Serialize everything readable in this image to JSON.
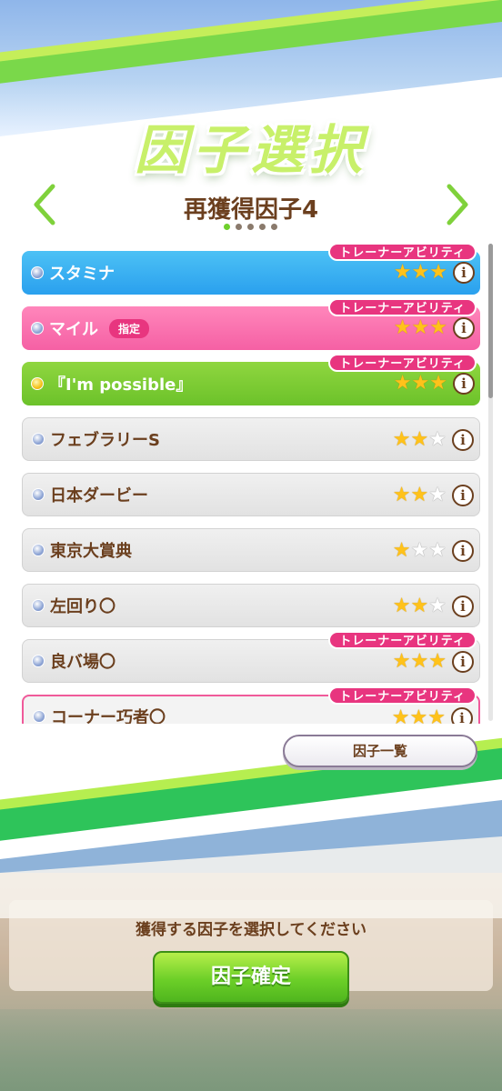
{
  "screen": {
    "title": "因子選択",
    "subtitle": "再獲得因子4",
    "page_count": 5,
    "active_page": 1
  },
  "factors": [
    {
      "name": "スタミナ",
      "stars": 3,
      "style": "blue",
      "bullet": "silver",
      "trainer_tag": "トレーナーアビリティ",
      "badge": ""
    },
    {
      "name": "マイル",
      "stars": 3,
      "style": "pink",
      "bullet": "silver",
      "trainer_tag": "トレーナーアビリティ",
      "badge": "指定"
    },
    {
      "name": "『I'm possible』",
      "stars": 3,
      "style": "green",
      "bullet": "gold",
      "trainer_tag": "トレーナーアビリティ",
      "badge": ""
    },
    {
      "name": "フェブラリーS",
      "stars": 2,
      "style": "gray",
      "bullet": "silver",
      "trainer_tag": "",
      "badge": ""
    },
    {
      "name": "日本ダービー",
      "stars": 2,
      "style": "gray",
      "bullet": "silver",
      "trainer_tag": "",
      "badge": ""
    },
    {
      "name": "東京大賞典",
      "stars": 1,
      "style": "gray",
      "bullet": "silver",
      "trainer_tag": "",
      "badge": ""
    },
    {
      "name": "左回り〇",
      "stars": 2,
      "style": "gray",
      "bullet": "silver",
      "trainer_tag": "",
      "badge": ""
    },
    {
      "name": "良バ場〇",
      "stars": 3,
      "style": "gray",
      "bullet": "silver",
      "trainer_tag": "トレーナーアビリティ",
      "badge": ""
    },
    {
      "name": "コーナー巧者〇",
      "stars": 3,
      "style": "pink-outline",
      "bullet": "silver",
      "trainer_tag": "トレーナーアビリティ",
      "badge": ""
    }
  ],
  "info_symbol": "i",
  "factor_list_button_label": "因子一覧",
  "instruction_text": "獲得する因子を選択してください",
  "confirm_button_label": "因子確定",
  "colors": {
    "accent_green": "#6ccf28",
    "tag_pink": "#e8357f",
    "text_brown": "#6b3f1e"
  }
}
